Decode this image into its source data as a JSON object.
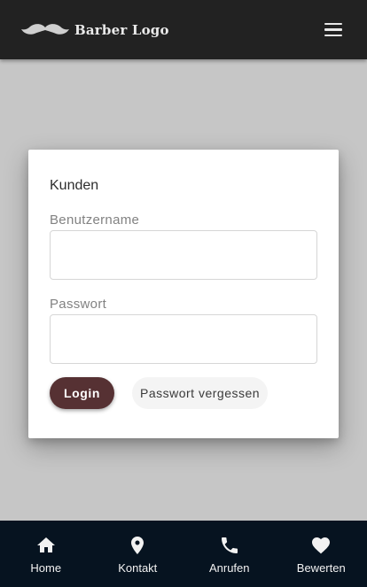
{
  "header": {
    "logo_text": "Barber Logo",
    "logo_icon": "mustache-icon",
    "menu_icon": "hamburger-menu-icon"
  },
  "dialog": {
    "title": "Kunden",
    "username_label": "Benutzername",
    "username_value": "",
    "password_label": "Passwort",
    "password_value": "",
    "login_label": "Login",
    "forgot_label": "Passwort vergessen"
  },
  "bottom_nav": {
    "items": [
      {
        "label": "Home",
        "icon": "home-icon"
      },
      {
        "label": "Kontakt",
        "icon": "location-pin-icon"
      },
      {
        "label": "Anrufen",
        "icon": "phone-icon"
      },
      {
        "label": "Bewerten",
        "icon": "heart-icon"
      }
    ]
  },
  "colors": {
    "header_bg": "#222222",
    "overlay_bg": "#c6c6c6",
    "primary_button": "#563133",
    "bottom_nav_bg": "#061320"
  }
}
